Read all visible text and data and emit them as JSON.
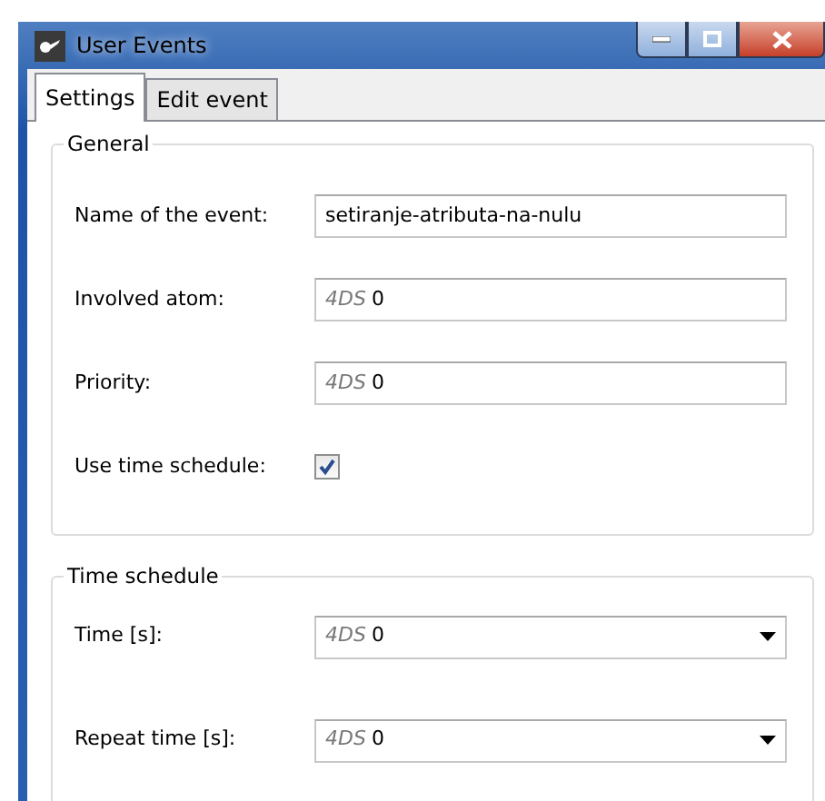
{
  "window": {
    "title": "User Events"
  },
  "tabs": [
    {
      "label": "Settings",
      "selected": true
    },
    {
      "label": "Edit event",
      "selected": false
    }
  ],
  "groups": [
    {
      "title": "General",
      "rows": [
        {
          "kind": "text",
          "label": "Name of the event:",
          "value": "setiranje-atributa-na-nulu"
        },
        {
          "kind": "prefixed",
          "label": "Involved atom:",
          "prefix": "4DS",
          "value": "0"
        },
        {
          "kind": "prefixed",
          "label": "Priority:",
          "prefix": "4DS",
          "value": "0"
        },
        {
          "kind": "checkbox",
          "label": "Use time schedule:",
          "checked": true
        }
      ]
    },
    {
      "title": "Time schedule",
      "rows": [
        {
          "kind": "combo",
          "label": "Time [s]:",
          "prefix": "4DS",
          "value": "0"
        },
        {
          "kind": "combo",
          "label": "Repeat time [s]:",
          "prefix": "4DS",
          "value": "0"
        }
      ]
    }
  ]
}
